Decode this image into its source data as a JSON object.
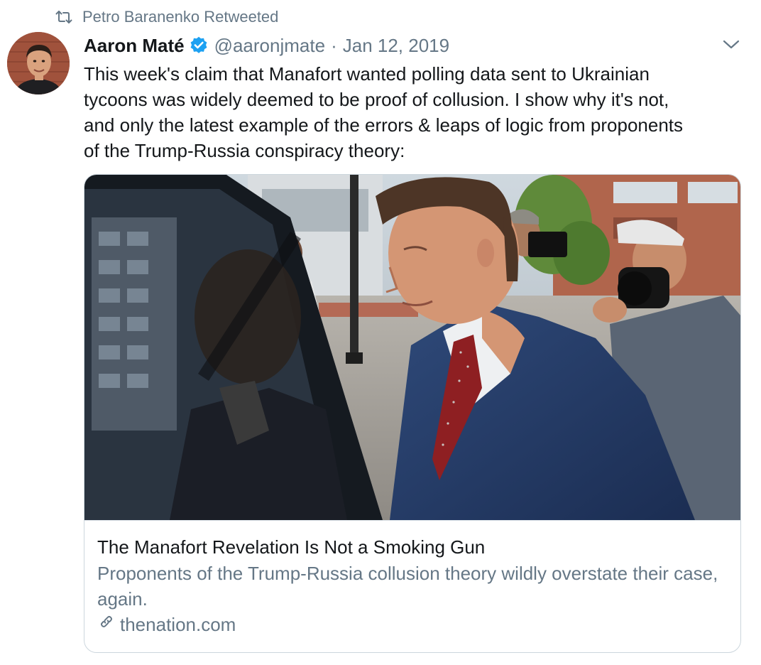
{
  "retweet": {
    "icon": "retweet-icon",
    "label": "Petro Baranenko Retweeted"
  },
  "tweet": {
    "author": {
      "display_name": "Aaron Maté",
      "handle": "@aaronjmate",
      "verified": true,
      "avatar_icon": "avatar"
    },
    "separator": "·",
    "date": "Jan 12, 2019",
    "text_lines": [
      "This week's claim that Manafort wanted polling data sent to Ukrainian",
      "tycoons was widely deemed to be proof of collusion. I show why it's not,",
      "and only the latest example of the errors & leaps of logic from proponents",
      "of the Trump-Russia conspiracy theory:"
    ]
  },
  "card": {
    "title": "The Manafort Revelation Is Not a Smoking Gun",
    "description": "Proponents of the Trump-Russia collusion theory wildly overstate their case, again.",
    "domain": "thenation.com",
    "domain_icon": "link-icon"
  },
  "colors": {
    "text_primary": "#14171a",
    "text_secondary": "#657786",
    "verified_blue": "#1da1f2",
    "card_border": "#ccd6dd"
  }
}
